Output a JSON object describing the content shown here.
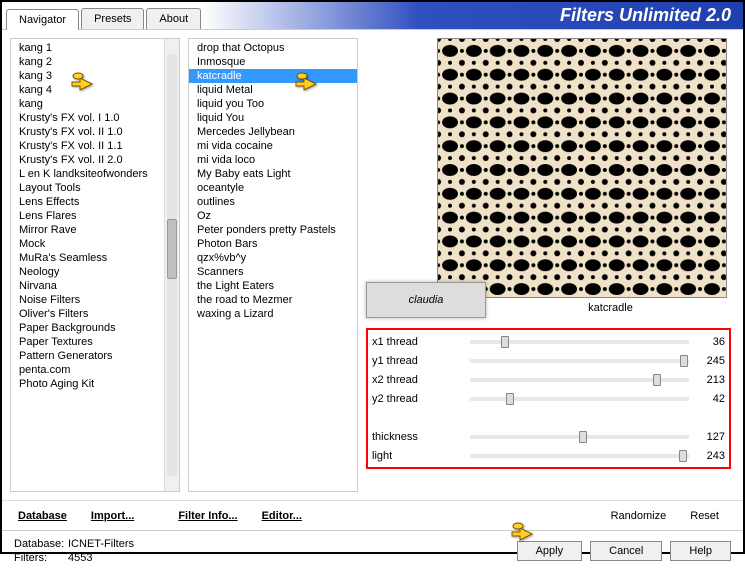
{
  "title": "Filters Unlimited 2.0",
  "tabs": [
    {
      "label": "Navigator",
      "active": true
    },
    {
      "label": "Presets",
      "active": false
    },
    {
      "label": "About",
      "active": false
    }
  ],
  "navigator_list": [
    "kang 1",
    "kang 2",
    "kang 3",
    "kang 4",
    "kang",
    "Krusty's FX vol. I 1.0",
    "Krusty's FX vol. II 1.0",
    "Krusty's FX vol. II 1.1",
    "Krusty's FX vol. II 2.0",
    "L en K landksiteofwonders",
    "Layout Tools",
    "Lens Effects",
    "Lens Flares",
    "Mirror Rave",
    "Mock",
    "MuRa's Seamless",
    "Neology",
    "Nirvana",
    "Noise Filters",
    "Oliver's Filters",
    "Paper Backgrounds",
    "Paper Textures",
    "Pattern Generators",
    "penta.com",
    "Photo Aging Kit"
  ],
  "navigator_selected_index": 2,
  "filter_list": [
    "drop that Octopus",
    "Inmosque",
    "katcradle",
    "liquid Metal",
    "liquid you Too",
    "liquid You",
    "Mercedes Jellybean",
    "mi vida cocaine",
    "mi vida loco",
    "My Baby eats Light",
    "oceantyle",
    "outlines",
    "Oz",
    "Peter ponders pretty Pastels",
    "Photon Bars",
    "qzx%vb^y",
    "Scanners",
    "the Light Eaters",
    "the road to Mezmer",
    "waxing a Lizard"
  ],
  "filter_selected_index": 2,
  "current_filter": "katcradle",
  "watermark": "claudia",
  "params": [
    {
      "label": "x1 thread",
      "value": 36,
      "max": 255
    },
    {
      "label": "y1 thread",
      "value": 245,
      "max": 255
    },
    {
      "label": "x2 thread",
      "value": 213,
      "max": 255
    },
    {
      "label": "y2 thread",
      "value": 42,
      "max": 255
    }
  ],
  "params2": [
    {
      "label": "thickness",
      "value": 127,
      "max": 255
    },
    {
      "label": "light",
      "value": 243,
      "max": 255
    }
  ],
  "bottom_links": {
    "database": "Database",
    "import": "Import...",
    "filter_info": "Filter Info...",
    "editor": "Editor...",
    "randomize": "Randomize",
    "reset": "Reset"
  },
  "footer": {
    "database_label": "Database:",
    "database_value": "ICNET-Filters",
    "filters_label": "Filters:",
    "filters_value": "4553"
  },
  "buttons": {
    "apply": "Apply",
    "cancel": "Cancel",
    "help": "Help"
  }
}
